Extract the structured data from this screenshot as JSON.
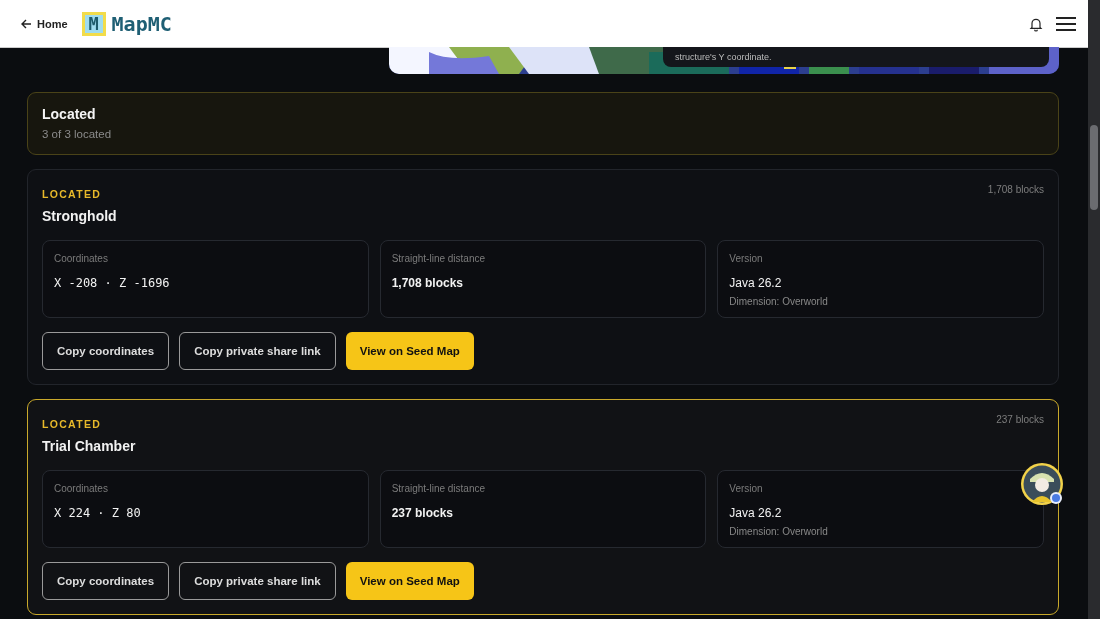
{
  "header": {
    "back_link": "Home",
    "logo_mark": "M",
    "logo": "MapMC"
  },
  "map_preview": {
    "tooltip": "structure's Y coordinate."
  },
  "summary": {
    "title": "Located",
    "subtitle": "3 of 3 located"
  },
  "structures": [
    {
      "status": "LOCATED",
      "name": "Stronghold",
      "distance_badge": "1,708 blocks",
      "selected": false,
      "fields": [
        {
          "label": "Coordinates",
          "value": "X -208 · Z -1696",
          "kind": "mono"
        },
        {
          "label": "Straight-line distance",
          "value": "1,708 blocks",
          "kind": "bold"
        },
        {
          "label": "Version",
          "value": "Java 26.2",
          "note": "Dimension: Overworld",
          "kind": "plain"
        }
      ],
      "buttons": [
        {
          "label": "Copy coordinates",
          "kind": "outline"
        },
        {
          "label": "Copy private share link",
          "kind": "outline"
        },
        {
          "label": "View on Seed Map",
          "kind": "primary"
        }
      ]
    },
    {
      "status": "LOCATED",
      "name": "Trial Chamber",
      "distance_badge": "237 blocks",
      "selected": true,
      "fields": [
        {
          "label": "Coordinates",
          "value": "X 224 · Z 80",
          "kind": "mono"
        },
        {
          "label": "Straight-line distance",
          "value": "237 blocks",
          "kind": "bold"
        },
        {
          "label": "Version",
          "value": "Java 26.2",
          "note": "Dimension: Overworld",
          "kind": "plain"
        }
      ],
      "buttons": [
        {
          "label": "Copy coordinates",
          "kind": "outline"
        },
        {
          "label": "Copy private share link",
          "kind": "outline"
        },
        {
          "label": "View on Seed Map",
          "kind": "primary"
        }
      ]
    }
  ]
}
